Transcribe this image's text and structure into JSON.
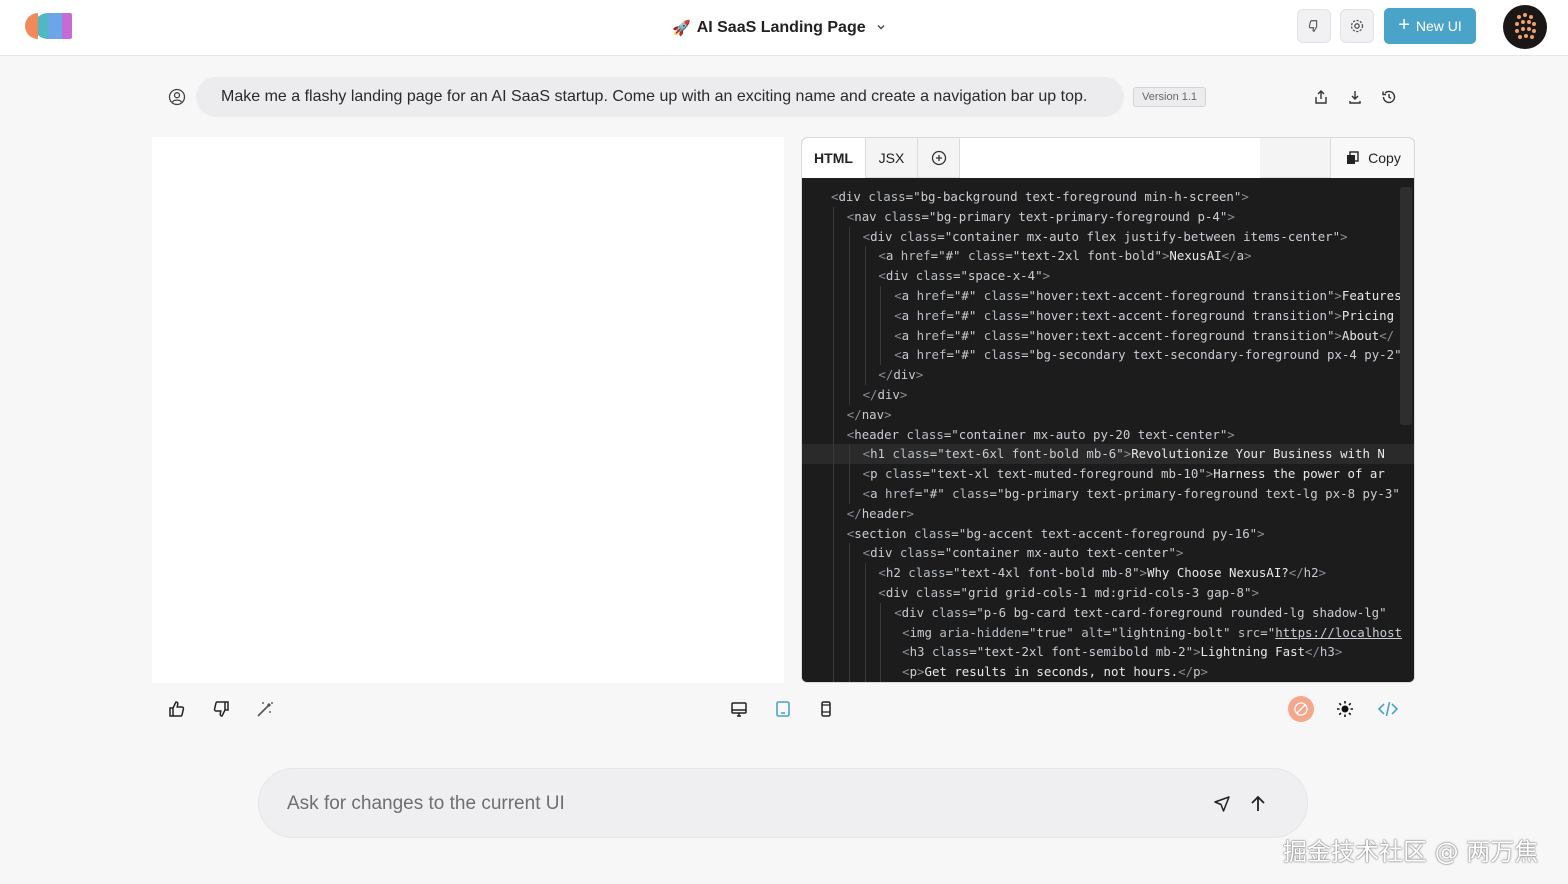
{
  "header": {
    "title_emoji": "🚀",
    "title": "AI SaaS Landing Page",
    "new_ui_label": "New UI",
    "buttons": [
      "feedback-icon",
      "settings-icon"
    ]
  },
  "prompt": {
    "text": "Make me a flashy landing page for an AI SaaS startup. Come up with an exciting name and create a navigation bar up top.",
    "version": "Version 1.1"
  },
  "code_panel": {
    "tabs": [
      "HTML",
      "JSX"
    ],
    "copy_label": "Copy",
    "lines": [
      {
        "indent": 0,
        "html": "<span class=\"tag\">&lt;</span><span class=\"tname\">div</span> <span class=\"attr\">class</span>=<span class=\"val\">\"bg-background text-foreground min-h-screen\"</span><span class=\"tag\">&gt;</span>"
      },
      {
        "indent": 1,
        "html": "<span class=\"tag\">&lt;</span><span class=\"tname\">nav</span> <span class=\"attr\">class</span>=<span class=\"val\">\"bg-primary text-primary-foreground p-4\"</span><span class=\"tag\">&gt;</span>"
      },
      {
        "indent": 2,
        "html": "<span class=\"tag\">&lt;</span><span class=\"tname\">div</span> <span class=\"attr\">class</span>=<span class=\"val\">\"container mx-auto flex justify-between items-center\"</span><span class=\"tag\">&gt;</span>"
      },
      {
        "indent": 3,
        "html": "<span class=\"tag\">&lt;</span><span class=\"tname\">a</span> <span class=\"attr\">href</span>=<span class=\"val\">\"#\"</span> <span class=\"attr\">class</span>=<span class=\"val\">\"text-2xl font-bold\"</span><span class=\"tag\">&gt;</span><span class=\"txt\">NexusAI</span><span class=\"tag\">&lt;/</span><span class=\"tname\">a</span><span class=\"tag\">&gt;</span>"
      },
      {
        "indent": 3,
        "html": "<span class=\"tag\">&lt;</span><span class=\"tname\">div</span> <span class=\"attr\">class</span>=<span class=\"val\">\"space-x-4\"</span><span class=\"tag\">&gt;</span>"
      },
      {
        "indent": 4,
        "html": "<span class=\"tag\">&lt;</span><span class=\"tname\">a</span> <span class=\"attr\">href</span>=<span class=\"val\">\"#\"</span> <span class=\"attr\">class</span>=<span class=\"val\">\"hover:text-accent-foreground transition\"</span><span class=\"tag\">&gt;</span><span class=\"txt\">Features</span>"
      },
      {
        "indent": 4,
        "html": "<span class=\"tag\">&lt;</span><span class=\"tname\">a</span> <span class=\"attr\">href</span>=<span class=\"val\">\"#\"</span> <span class=\"attr\">class</span>=<span class=\"val\">\"hover:text-accent-foreground transition\"</span><span class=\"tag\">&gt;</span><span class=\"txt\">Pricing</span>"
      },
      {
        "indent": 4,
        "html": "<span class=\"tag\">&lt;</span><span class=\"tname\">a</span> <span class=\"attr\">href</span>=<span class=\"val\">\"#\"</span> <span class=\"attr\">class</span>=<span class=\"val\">\"hover:text-accent-foreground transition\"</span><span class=\"tag\">&gt;</span><span class=\"txt\">About</span><span class=\"tag\">&lt;/</span>"
      },
      {
        "indent": 4,
        "html": "<span class=\"tag\">&lt;</span><span class=\"tname\">a</span> <span class=\"attr\">href</span>=<span class=\"val\">\"#\"</span> <span class=\"attr\">class</span>=<span class=\"val\">\"bg-secondary text-secondary-foreground px-4 py-2\"</span>"
      },
      {
        "indent": 3,
        "html": "<span class=\"tag\">&lt;/</span><span class=\"tname\">div</span><span class=\"tag\">&gt;</span>"
      },
      {
        "indent": 2,
        "html": "<span class=\"tag\">&lt;/</span><span class=\"tname\">div</span><span class=\"tag\">&gt;</span>"
      },
      {
        "indent": 1,
        "html": "<span class=\"tag\">&lt;/</span><span class=\"tname\">nav</span><span class=\"tag\">&gt;</span>"
      },
      {
        "indent": 1,
        "html": "<span class=\"tag\">&lt;</span><span class=\"tname\">header</span> <span class=\"attr\">class</span>=<span class=\"val\">\"container mx-auto py-20 text-center\"</span><span class=\"tag\">&gt;</span>"
      },
      {
        "indent": 2,
        "hl": true,
        "html": "<span class=\"tag\">&lt;</span><span class=\"tname\">h1</span> <span class=\"attr\">class</span>=<span class=\"val\">\"text-6xl font-bold mb-6\"</span><span class=\"tag\">&gt;</span><span class=\"txt\">Revolutionize Your Business with N</span>"
      },
      {
        "indent": 2,
        "html": "<span class=\"tag\">&lt;</span><span class=\"tname\">p</span> <span class=\"attr\">class</span>=<span class=\"val\">\"text-xl text-muted-foreground mb-10\"</span><span class=\"tag\">&gt;</span><span class=\"txt\">Harness the power of ar</span>"
      },
      {
        "indent": 2,
        "html": "<span class=\"tag\">&lt;</span><span class=\"tname\">a</span> <span class=\"attr\">href</span>=<span class=\"val\">\"#\"</span> <span class=\"attr\">class</span>=<span class=\"val\">\"bg-primary text-primary-foreground text-lg px-8 py-3\"</span>"
      },
      {
        "indent": 1,
        "html": "<span class=\"tag\">&lt;/</span><span class=\"tname\">header</span><span class=\"tag\">&gt;</span>"
      },
      {
        "indent": 1,
        "html": "<span class=\"tag\">&lt;</span><span class=\"tname\">section</span> <span class=\"attr\">class</span>=<span class=\"val\">\"bg-accent text-accent-foreground py-16\"</span><span class=\"tag\">&gt;</span>"
      },
      {
        "indent": 2,
        "html": "<span class=\"tag\">&lt;</span><span class=\"tname\">div</span> <span class=\"attr\">class</span>=<span class=\"val\">\"container mx-auto text-center\"</span><span class=\"tag\">&gt;</span>"
      },
      {
        "indent": 3,
        "html": "<span class=\"tag\">&lt;</span><span class=\"tname\">h2</span> <span class=\"attr\">class</span>=<span class=\"val\">\"text-4xl font-bold mb-8\"</span><span class=\"tag\">&gt;</span><span class=\"txt\">Why Choose NexusAI?</span><span class=\"tag\">&lt;/</span><span class=\"tname\">h2</span><span class=\"tag\">&gt;</span>"
      },
      {
        "indent": 3,
        "html": "<span class=\"tag\">&lt;</span><span class=\"tname\">div</span> <span class=\"attr\">class</span>=<span class=\"val\">\"grid grid-cols-1 md:grid-cols-3 gap-8\"</span><span class=\"tag\">&gt;</span>"
      },
      {
        "indent": 4,
        "html": "<span class=\"tag\">&lt;</span><span class=\"tname\">div</span> <span class=\"attr\">class</span>=<span class=\"val\">\"p-6 bg-card text-card-foreground rounded-lg shadow-lg\"</span>"
      },
      {
        "indent": 4,
        "extra": 1,
        "html": "<span class=\"tag\">&lt;</span><span class=\"tname\">img</span> <span class=\"attr\">aria-hidden</span>=<span class=\"val\">\"true\"</span> <span class=\"attr\">alt</span>=<span class=\"val\">\"lightning-bolt\"</span> <span class=\"attr\">src</span>=<span class=\"val\">\"<u>https://localhost</u></span>"
      },
      {
        "indent": 4,
        "extra": 1,
        "html": "<span class=\"tag\">&lt;</span><span class=\"tname\">h3</span> <span class=\"attr\">class</span>=<span class=\"val\">\"text-2xl font-semibold mb-2\"</span><span class=\"tag\">&gt;</span><span class=\"txt\">Lightning Fast</span><span class=\"tag\">&lt;/</span><span class=\"tname\">h3</span><span class=\"tag\">&gt;</span>"
      },
      {
        "indent": 4,
        "extra": 1,
        "html": "<span class=\"tag\">&lt;</span><span class=\"tname\">p</span><span class=\"tag\">&gt;</span><span class=\"txt\">Get results in seconds, not hours.</span><span class=\"tag\">&lt;/</span><span class=\"tname\">p</span><span class=\"tag\">&gt;</span>"
      }
    ]
  },
  "input": {
    "placeholder": "Ask for changes to the current UI"
  },
  "watermark": "掘金技术社区 @ 两万焦",
  "colors": {
    "accent": "#4aa3c8",
    "code_bg": "#1c1c1c"
  }
}
